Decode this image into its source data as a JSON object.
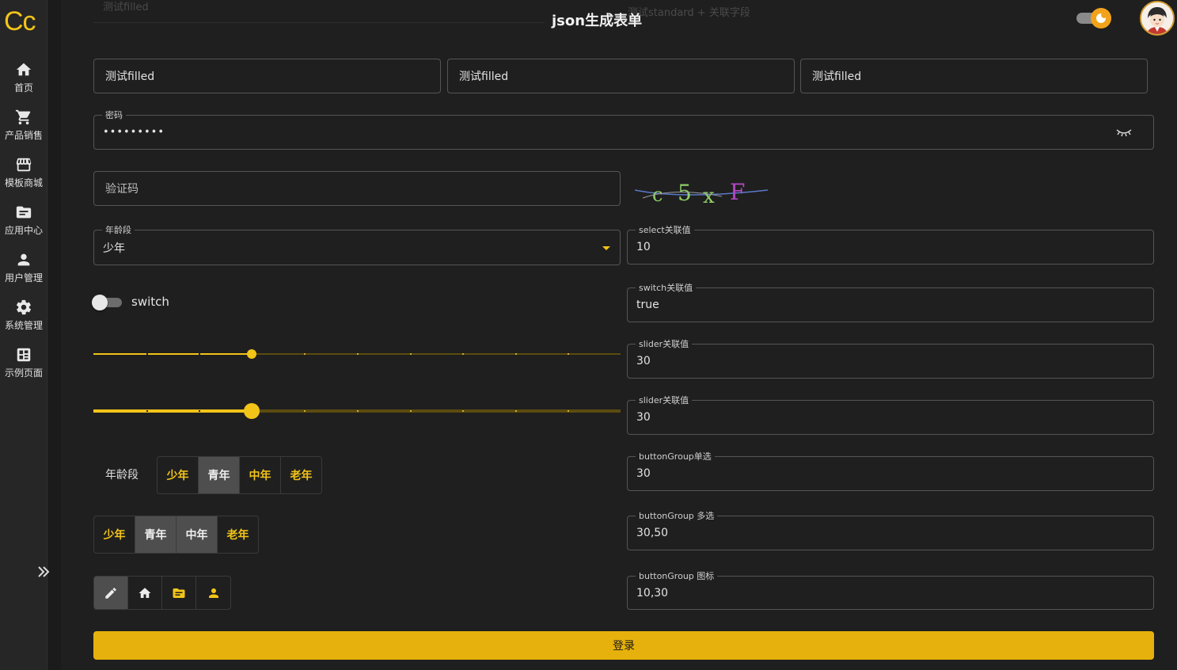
{
  "app": {
    "logo": "Cc",
    "title": "json生成表单"
  },
  "ghost": {
    "left": "测试filled",
    "right": "测试standard + 关联字段"
  },
  "sidebar": {
    "items": [
      {
        "label": "首页",
        "icon": "home-icon"
      },
      {
        "label": "产品销售",
        "icon": "cart-icon"
      },
      {
        "label": "模板商城",
        "icon": "store-icon"
      },
      {
        "label": "应用中心",
        "icon": "folder-icon"
      },
      {
        "label": "用户管理",
        "icon": "user-icon"
      },
      {
        "label": "系统管理",
        "icon": "gear-icon"
      },
      {
        "label": "示例页面",
        "icon": "dashboard-icon"
      }
    ]
  },
  "form": {
    "filled": [
      "测试filled",
      "测试filled",
      "测试filled"
    ],
    "password": {
      "label": "密码",
      "value": "•••••••••"
    },
    "captcha": {
      "placeholder": "验证码",
      "code": "c5xF"
    },
    "age_select": {
      "label": "年龄段",
      "value": "少年"
    },
    "switch": {
      "label": "switch",
      "checked": false
    },
    "slider1": {
      "value": 30
    },
    "slider2": {
      "value": 30
    },
    "linked": [
      {
        "label": "select关联值",
        "value": "10"
      },
      {
        "label": "switch关联值",
        "value": "true"
      },
      {
        "label": "slider关联值",
        "value": "30"
      },
      {
        "label": "slider关联值",
        "value": "30"
      },
      {
        "label": "buttonGroup单选",
        "value": "30"
      },
      {
        "label": "buttonGroup 多选",
        "value": "30,50"
      },
      {
        "label": "buttonGroup 图标",
        "value": "10,30"
      }
    ],
    "button_group_label": "年龄段",
    "single_group": [
      "少年",
      "青年",
      "中年",
      "老年"
    ],
    "multi_group": [
      "少年",
      "青年",
      "中年",
      "老年"
    ],
    "icon_group": [
      "pencil-icon",
      "home-icon",
      "folder-icon",
      "user-icon"
    ],
    "submit": "登录"
  },
  "colors": {
    "accent": "#f2c418",
    "button": "#e6b10c",
    "background": "#1f1f1f"
  }
}
